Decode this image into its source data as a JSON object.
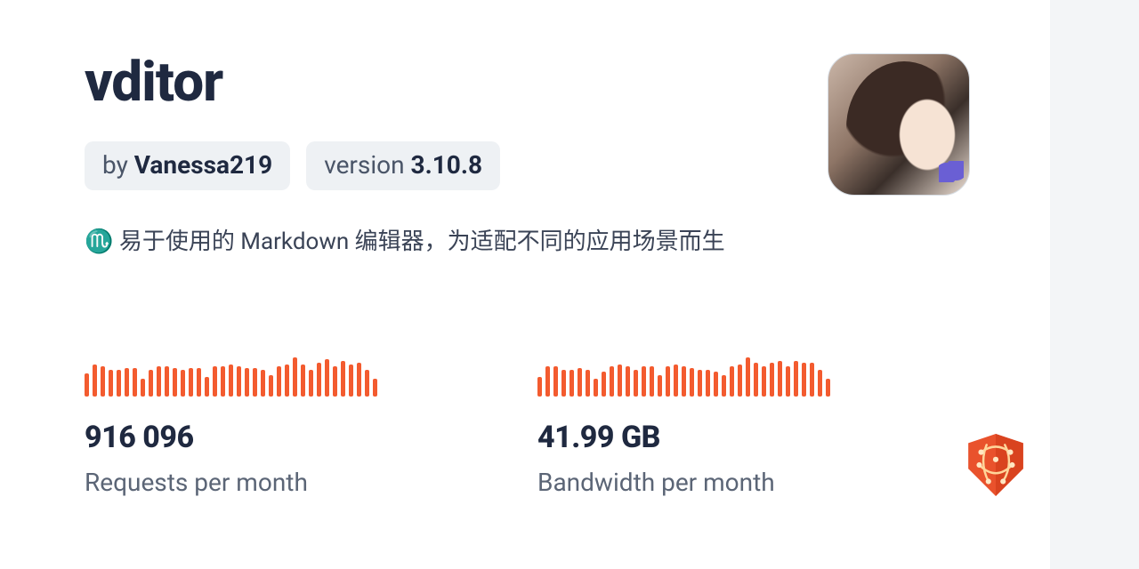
{
  "package": {
    "name": "vditor",
    "author_prefix": "by ",
    "author": "Vanessa219",
    "version_prefix": "version ",
    "version": "3.10.8",
    "description": "♏ 易于使用的 Markdown 编辑器，为适配不同的应用场景而生"
  },
  "stats": {
    "requests": {
      "value": "916 096",
      "label": "Requests per month"
    },
    "bandwidth": {
      "value": "41.99 GB",
      "label": "Bandwidth per month"
    }
  },
  "chart_data": [
    {
      "type": "bar",
      "name": "requests_sparkline",
      "values": [
        26,
        36,
        34,
        30,
        30,
        32,
        32,
        20,
        30,
        34,
        34,
        32,
        30,
        32,
        32,
        22,
        34,
        34,
        36,
        34,
        32,
        32,
        30,
        24,
        34,
        36,
        44,
        36,
        30,
        38,
        42,
        34,
        40,
        36,
        38,
        30,
        20
      ],
      "ylim": [
        0,
        46
      ]
    },
    {
      "type": "bar",
      "name": "bandwidth_sparkline",
      "values": [
        22,
        34,
        34,
        30,
        30,
        32,
        30,
        20,
        28,
        34,
        36,
        34,
        30,
        34,
        34,
        24,
        34,
        36,
        34,
        32,
        30,
        30,
        28,
        24,
        34,
        36,
        44,
        38,
        34,
        38,
        40,
        34,
        40,
        38,
        38,
        30,
        20
      ],
      "ylim": [
        0,
        46
      ]
    }
  ],
  "brand": {
    "name": "jsDelivr"
  }
}
